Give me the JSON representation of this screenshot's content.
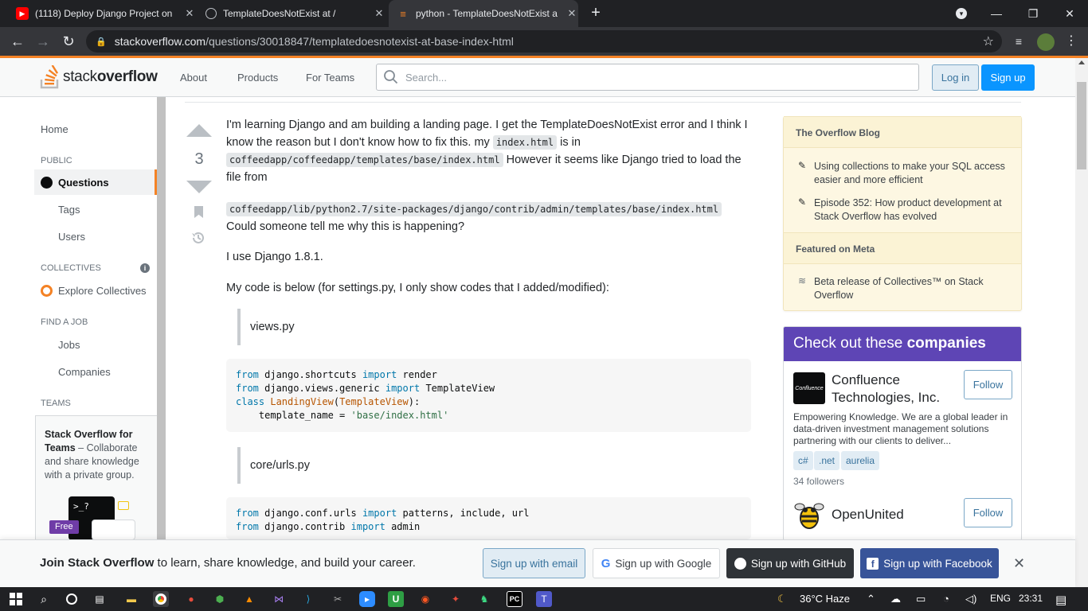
{
  "browser": {
    "tabs": [
      {
        "title": "(1118) Deploy Django Project on",
        "icon": "youtube-icon"
      },
      {
        "title": "TemplateDoesNotExist at /",
        "icon": "globe-icon"
      },
      {
        "title": "python - TemplateDoesNotExist a",
        "icon": "stackoverflow-icon",
        "active": true
      }
    ],
    "url_host": "stackoverflow.com",
    "url_path": "/questions/30018847/templatedoesnotexist-at-base-index-html"
  },
  "header": {
    "logo_light": "stack",
    "logo_bold": "overflow",
    "nav": [
      "About",
      "Products",
      "For Teams"
    ],
    "search_placeholder": "Search...",
    "login": "Log in",
    "signup": "Sign up",
    "brand_color": "#f48225"
  },
  "sidebar": {
    "home": "Home",
    "public_head": "PUBLIC",
    "questions": "Questions",
    "tags": "Tags",
    "users": "Users",
    "collectives_head": "COLLECTIVES",
    "explore_collectives": "Explore Collectives",
    "jobs_head": "FIND A JOB",
    "jobs": "Jobs",
    "companies": "Companies",
    "teams_head": "TEAMS",
    "teams_bold_1": "Stack Overflow for",
    "teams_bold_2": "Teams",
    "teams_text": " – Collaborate and share knowledge with a private group.",
    "free_badge": "Free"
  },
  "question": {
    "votes": "3",
    "p1_a": "I'm learning Django and am building a landing page. I get the TemplateDoesNotExist error and I think I know the reason but I don't know how to fix this. my ",
    "p1_code1": "index.html",
    "p1_b": " is in",
    "p1_code2": "coffeedapp/coffeedapp/templates/base/index.html",
    "p1_c": " However it seems like Django tried to load the file from",
    "p2_code": "coffeedapp/lib/python2.7/site-packages/django/contrib/admin/templates/base/index.html",
    "p2_text": " Could someone tell me why this is happening?",
    "p3": "I use Django 1.8.1.",
    "p4": "My code is below (for settings.py, I only show codes that I added/modified):",
    "quote1": "views.py",
    "quote2": "core/urls.py",
    "code1": {
      "l1_kw": "from",
      "l1_a": " django.shortcuts ",
      "l1_kw2": "import",
      "l1_b": " render",
      "l2_kw": "from",
      "l2_a": " django.views.generic ",
      "l2_kw2": "import",
      "l2_b": " TemplateView",
      "l3_kw": "class",
      "l3_cls": " LandingView",
      "l3_a": "(",
      "l3_base": "TemplateView",
      "l3_b": "):",
      "l4_a": "    template_name = ",
      "l4_str": "'base/index.html'"
    },
    "code2": {
      "l1_kw": "from",
      "l1_a": " django.conf.urls ",
      "l1_kw2": "import",
      "l1_b": " patterns, include, url",
      "l2_kw": "from",
      "l2_a": " django.contrib ",
      "l2_kw2": "import",
      "l2_b": " admin"
    }
  },
  "blog": {
    "head": "The Overflow Blog",
    "items": [
      "Using collections to make your SQL access easier and more efficient",
      "Episode 352: How product development at Stack Overflow has evolved"
    ],
    "meta_head": "Featured on Meta",
    "meta_items": [
      "Beta release of Collectives™ on Stack Overflow"
    ]
  },
  "companies": {
    "head_a": "Check out these ",
    "head_b": "companies",
    "list": [
      {
        "name": "Confluence Technologies, Inc.",
        "logo_text": "Confluence",
        "follow": "Follow",
        "description": "Empowering Knowledge. We are a global leader in data-driven investment management solutions partnering with our clients to deliver...",
        "tags": [
          "c#",
          ".net",
          "aurelia"
        ],
        "followers": "34 followers"
      },
      {
        "name": "OpenUnited",
        "follow": "Follow"
      }
    ]
  },
  "join_banner": {
    "bold": "Join Stack Overflow",
    "text": " to learn, share knowledge, and build your career.",
    "email": "Sign up with email",
    "google": "Sign up with Google",
    "github": "Sign up with GitHub",
    "facebook": "Sign up with Facebook"
  },
  "taskbar": {
    "weather": "36°C  Haze",
    "lang": "ENG",
    "time": "23:31"
  }
}
